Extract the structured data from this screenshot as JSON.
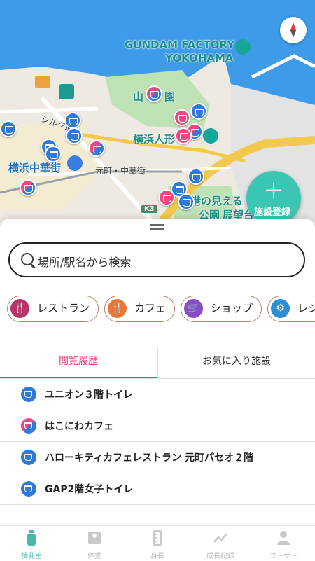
{
  "map": {
    "labels": {
      "gundam_line1": "GUNDAM FACTORY",
      "gundam_line2": "YOKOHAMA",
      "yamashita_park_a": "山",
      "yamashita_park_b": "園",
      "yokohama_doll": "横浜人形",
      "chinatown": "横浜中華街",
      "motomachi_station": "元町・中華街",
      "silk_street": "シルク通",
      "minato_view_line1": "港の見える",
      "minato_view_line2": "公園",
      "tenbo": "展望台",
      "route": "K3"
    },
    "colors": {
      "water": "#3d9be9",
      "land": "#eeeae2",
      "expressway": "#f2c94c",
      "park": "#bfe2b5"
    }
  },
  "fab": {
    "label": "施設登録",
    "color": "#3cc5b3"
  },
  "search": {
    "placeholder": "場所/駅名から検索"
  },
  "categories": [
    {
      "label": "レストラン",
      "icon": "restaurant-icon",
      "color": "#b8326b"
    },
    {
      "label": "カフェ",
      "icon": "cafe-icon",
      "color": "#e8783a"
    },
    {
      "label": "ショップ",
      "icon": "shop-icon",
      "color": "#8a4bc6"
    },
    {
      "label": "レジ",
      "icon": "leisure-icon",
      "color": "#2c8fd6"
    }
  ],
  "tabs": {
    "history": "閲覧履歴",
    "favorites": "お気に入り施設",
    "active_color": "#e33a7a"
  },
  "history": [
    {
      "name": "ユニオン３階トイレ",
      "icon": "diaper-icon-blue"
    },
    {
      "name": "はこにわカフェ",
      "icon": "nursing-icon-split"
    },
    {
      "name": "ハローキティカフェレストラン 元町パセオ２階",
      "icon": "diaper-icon-blue"
    },
    {
      "name": "GAP2階女子トイレ",
      "icon": "diaper-icon-blue"
    }
  ],
  "nav": [
    {
      "label": "授乳室",
      "icon": "bottle-icon"
    },
    {
      "label": "体重",
      "icon": "scale-icon"
    },
    {
      "label": "身長",
      "icon": "ruler-icon"
    },
    {
      "label": "成長記録",
      "icon": "chart-icon"
    },
    {
      "label": "ユーザー",
      "icon": "user-icon"
    }
  ]
}
